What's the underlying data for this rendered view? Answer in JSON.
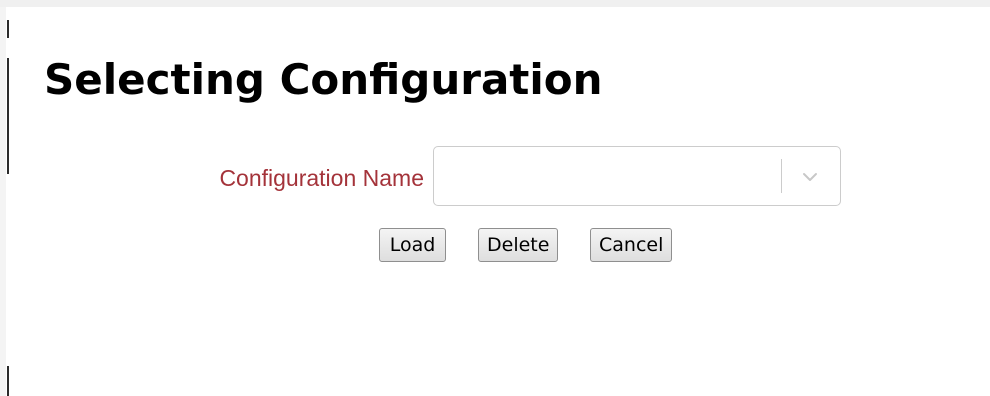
{
  "dialog": {
    "title": "Selecting Configuration",
    "field": {
      "label": "Configuration Name",
      "value": ""
    },
    "buttons": {
      "load": "Load",
      "delete": "Delete",
      "cancel": "Cancel"
    }
  },
  "colors": {
    "label": "#a4333a",
    "border": "#cccccc",
    "chevron": "#cccccc"
  },
  "icons": {
    "select_chevron": "chevron-down-icon"
  }
}
